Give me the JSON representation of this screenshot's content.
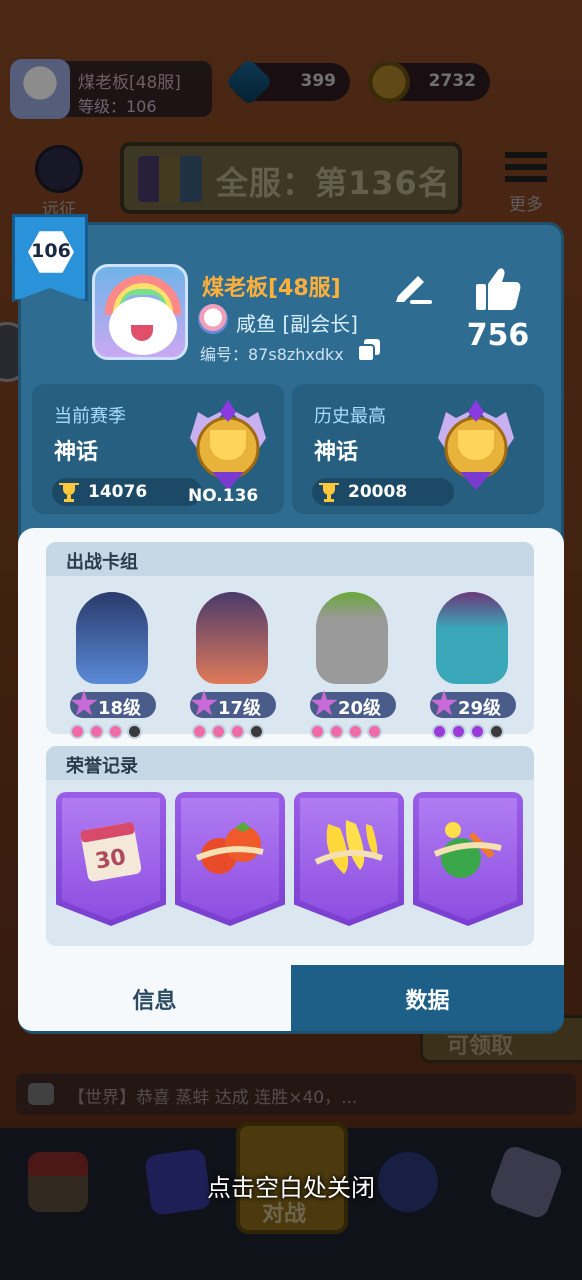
{
  "background": {
    "player": {
      "name": "煤老板[48服]",
      "level_text": "等级：106"
    },
    "gems": "399",
    "coins": "2732",
    "expedition_label": "远征",
    "rank_banner": "全服：第136名",
    "more_label": "更多",
    "claim_label": "可领取",
    "chat_text": "【世界】恭喜 蒸蚌 达成 连胜×40，...",
    "battle_label": "对战"
  },
  "profile": {
    "level": "106",
    "name": "煤老板[48服]",
    "clan": "咸鱼 [副会长]",
    "id_text": "编号：87s8zhxdkx",
    "likes": "756"
  },
  "current_season": {
    "label": "当前赛季",
    "tier": "神话",
    "trophies": "14076",
    "rank": "NO.136"
  },
  "best_season": {
    "label": "历史最高",
    "tier": "神话",
    "trophies": "20008"
  },
  "deck": {
    "title": "出战卡组",
    "heroes": [
      {
        "level": "18级",
        "stars": 3
      },
      {
        "level": "17级",
        "stars": 3
      },
      {
        "level": "20级",
        "stars": 4
      },
      {
        "level": "29级",
        "stars": 3
      }
    ]
  },
  "honor": {
    "title": "荣誉记录",
    "medals": [
      "30-day-calendar-medal",
      "tomato-medal",
      "banana-medal",
      "vegetable-medal"
    ],
    "calendar_text": "30"
  },
  "tabs": {
    "info": "信息",
    "data": "数据"
  },
  "close_hint": "点击空白处关闭",
  "colors": {
    "name": "#ffb03a",
    "modal": "#2e6d91",
    "medal": "#8d4ee0",
    "active_tab": "#1d5f86"
  }
}
